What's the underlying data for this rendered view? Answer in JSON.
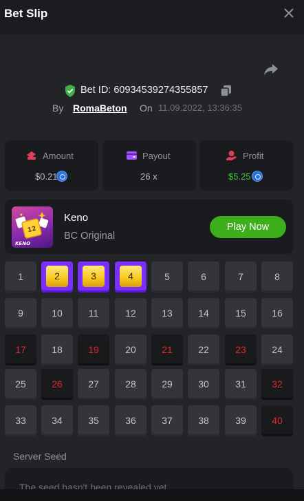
{
  "header": {
    "title": "Bet Slip",
    "close_icon": "close-icon"
  },
  "bet": {
    "id_label": "Bet ID: 60934539274355857",
    "by_label": "By",
    "user": "RomaBeton",
    "on_label": "On",
    "date": "11.09.2022, 13:36:35"
  },
  "stats": {
    "amount": {
      "label": "Amount",
      "value": "$0.21",
      "icon": "amount-icon",
      "color": "#e0405a"
    },
    "payout": {
      "label": "Payout",
      "value": "26 x",
      "icon": "wallet-icon",
      "color": "#a452ff"
    },
    "profit": {
      "label": "Profit",
      "value": "$5.25",
      "icon": "profit-icon",
      "color": "#e0405a",
      "value_color": "#3fc23a"
    }
  },
  "game": {
    "name": "Keno",
    "subtitle": "BC Original",
    "play_label": "Play Now",
    "thumb_label": "KENO",
    "accent": "#3fae1d"
  },
  "grid": {
    "numbers": [
      "1",
      "2",
      "3",
      "4",
      "5",
      "6",
      "7",
      "8",
      "9",
      "10",
      "11",
      "12",
      "13",
      "14",
      "15",
      "16",
      "17",
      "18",
      "19",
      "20",
      "21",
      "22",
      "23",
      "24",
      "25",
      "26",
      "27",
      "28",
      "29",
      "30",
      "31",
      "32",
      "33",
      "34",
      "35",
      "36",
      "37",
      "38",
      "39",
      "40"
    ],
    "picked": [
      "2",
      "3",
      "4"
    ],
    "drawn": [
      "17",
      "19",
      "21",
      "23",
      "26",
      "32",
      "40"
    ],
    "picked_color": "#7b2fff",
    "drawn_color": "#e02a2a"
  },
  "seed": {
    "label": "Server Seed",
    "value": "The seed hasn't been revealed yet"
  }
}
